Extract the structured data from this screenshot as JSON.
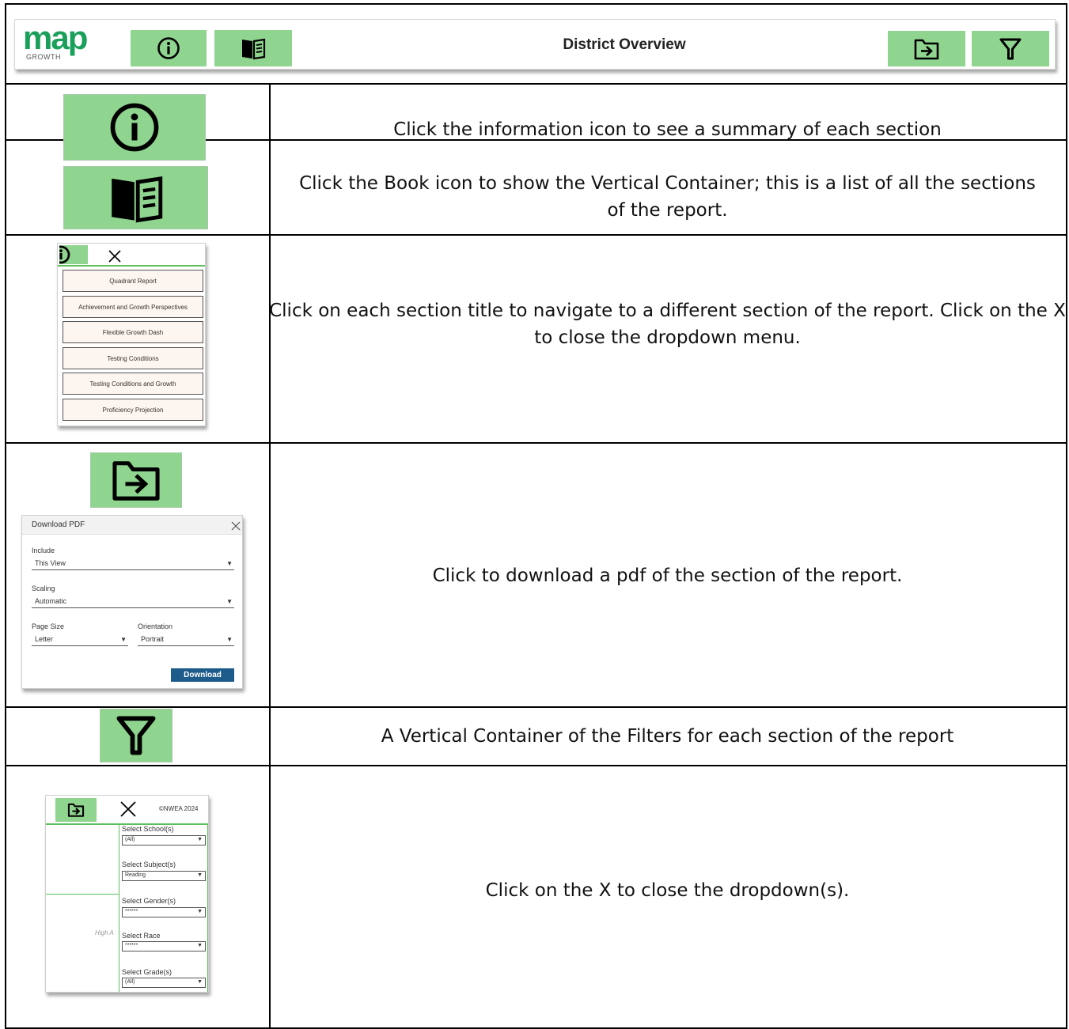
{
  "header": {
    "logo_text": "map",
    "logo_subtext": "GROWTH",
    "title": "District Overview",
    "info_icon": "info-icon",
    "book_icon": "book-icon",
    "download_icon": "folder-arrow-icon",
    "filter_icon": "filter-icon",
    "accent_color": "#8fd48f",
    "logo_color": "#1aa05a"
  },
  "rows": [
    {
      "icon": "info-icon",
      "description": "Click the information icon to see a summary of each section"
    },
    {
      "icon": "book-icon",
      "description": "Click the Book icon to show the Vertical Container; this is a list of all the sections of the report."
    },
    {
      "icon": "section-menu",
      "description": "Click on each section title to navigate to a different section of the report. Click on the X to close the dropdown menu."
    },
    {
      "icon": "download-dialog",
      "description": "Click to download a pdf of the section of the report."
    },
    {
      "icon": "filter-icon",
      "description": "A Vertical Container of the Filters for each section of the report"
    },
    {
      "icon": "filter-panel",
      "description": "Click on the X to close the dropdown(s)."
    }
  ],
  "section_menu": {
    "items": [
      "Quadrant Report",
      "Achievement and Growth Perspectives",
      "Flexible Growth Dash",
      "Testing Conditions",
      "Testing Conditions and Growth",
      "Proficiency Projection"
    ]
  },
  "download_dialog": {
    "title": "Download PDF",
    "include_label": "Include",
    "include_value": "This View",
    "scaling_label": "Scaling",
    "scaling_value": "Automatic",
    "page_size_label": "Page Size",
    "page_size_value": "Letter",
    "orientation_label": "Orientation",
    "orientation_value": "Portrait",
    "download_button": "Download"
  },
  "filter_panel": {
    "copyright": "©NWEA 2024",
    "partial_text": "High A",
    "filters": [
      {
        "label": "Select School(s)",
        "value": "(All)"
      },
      {
        "label": "Select Subject(s)",
        "value": "Reading"
      },
      {
        "label": "Select Gender(s)",
        "value": "******"
      },
      {
        "label": "Select Race",
        "value": "******"
      },
      {
        "label": "Select Grade(s)",
        "value": "(All)"
      }
    ]
  }
}
